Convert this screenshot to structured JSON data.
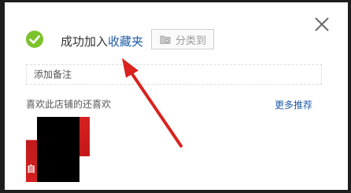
{
  "dialog": {
    "close_icon": "close-icon",
    "success": {
      "icon": "check-circle-icon",
      "icon_color": "#7cc22c",
      "prefix_text": "成功加入",
      "link_text": "收藏夹",
      "link_color": "#1f5ba5"
    },
    "category_button": {
      "icon": "folder-icon",
      "label": "分类到"
    },
    "note_field": {
      "placeholder": "添加备注"
    },
    "recommendations": {
      "title": "喜欢此店铺的还喜欢",
      "more_label": "更多推荐",
      "items": [
        {
          "label_fragment": "自"
        }
      ]
    },
    "annotation": {
      "type": "red-arrow",
      "color": "#d8231f"
    }
  }
}
